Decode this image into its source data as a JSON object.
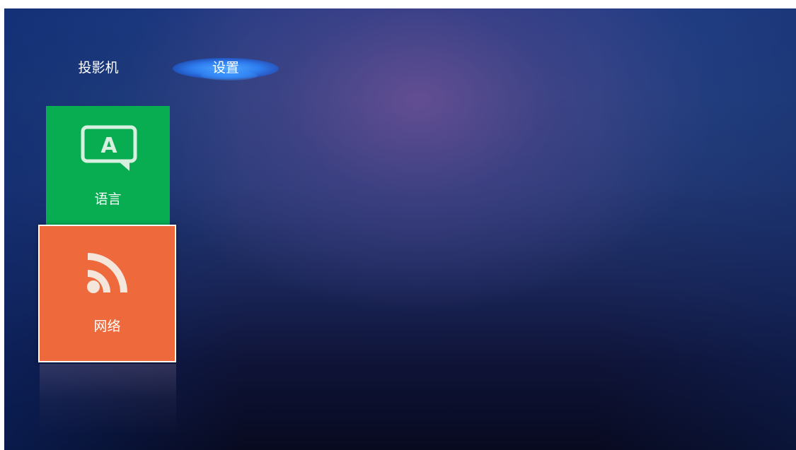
{
  "nav": {
    "tabs": [
      {
        "label": "投影机",
        "selected": false
      },
      {
        "label": "设置",
        "selected": true
      }
    ]
  },
  "tiles": {
    "language": {
      "label": "语言",
      "icon": "language-icon",
      "color": "#08ad52"
    },
    "network": {
      "label": "网络",
      "icon": "rss-network-icon",
      "color": "#ee6a3c",
      "focused": true
    }
  },
  "colors": {
    "tab_highlight": "#2e7df0",
    "background": "#1f3a82"
  }
}
